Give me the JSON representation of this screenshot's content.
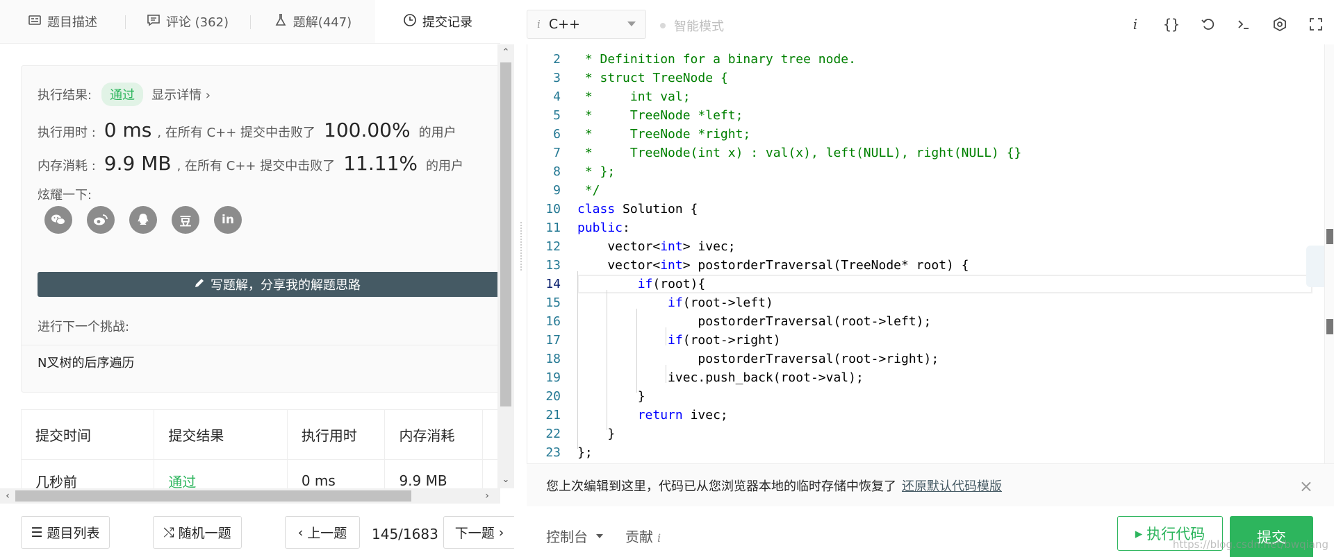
{
  "tabs": [
    {
      "label": "题目描述",
      "icon": "description-icon"
    },
    {
      "label": "评论 (362)",
      "icon": "comment-icon"
    },
    {
      "label": "题解(447)",
      "icon": "flask-icon"
    },
    {
      "label": "提交记录",
      "icon": "clock-icon"
    }
  ],
  "result": {
    "label": "执行结果:",
    "status": "通过",
    "detail": "显示详情 ›",
    "time_label": "执行用时 :",
    "time_value": "0 ms",
    "time_text": ", 在所有 C++ 提交中击败了",
    "time_percent": "100.00%",
    "time_suffix": "的用户",
    "mem_label": "内存消耗 :",
    "mem_value": "9.9 MB",
    "mem_text": ", 在所有 C++ 提交中击败了",
    "mem_percent": "11.11%",
    "mem_suffix": "的用户",
    "share_label": "炫耀一下:",
    "socials": [
      "wechat-icon",
      "weibo-icon",
      "qq-icon",
      "douban-icon",
      "linkedin-icon"
    ],
    "social_glyphs": {
      "douban": "豆",
      "linkedin": "in"
    },
    "write_button": "写题解，分享我的解题思路",
    "next_label": "进行下一个挑战:",
    "next_title": "N叉树的后序遍历"
  },
  "table": {
    "headers": [
      "提交时间",
      "提交结果",
      "执行用时",
      "内存消耗"
    ],
    "rows": [
      {
        "time": "几秒前",
        "result": "通过",
        "runtime": "0 ms",
        "memory": "9.9 MB"
      }
    ]
  },
  "bottom": {
    "list": "题目列表",
    "random": "随机一题",
    "prev": "上一题",
    "page": "145/1683",
    "next": "下一题"
  },
  "editor": {
    "language": "C++",
    "lang_icon": "i",
    "smart_mode": "智能模式",
    "lines": [
      {
        "n": "2",
        "html": "<span class='cm'> * Definition for a binary tree node.</span>"
      },
      {
        "n": "3",
        "html": "<span class='cm'> * struct TreeNode {</span>"
      },
      {
        "n": "4",
        "html": "<span class='cm'> *     int val;</span>"
      },
      {
        "n": "5",
        "html": "<span class='cm'> *     TreeNode *left;</span>"
      },
      {
        "n": "6",
        "html": "<span class='cm'> *     TreeNode *right;</span>"
      },
      {
        "n": "7",
        "html": "<span class='cm'> *     TreeNode(int x) : val(x), left(NULL), right(NULL) {}</span>"
      },
      {
        "n": "8",
        "html": "<span class='cm'> * };</span>"
      },
      {
        "n": "9",
        "html": "<span class='cm'> */</span>"
      },
      {
        "n": "10",
        "html": "<span class='kw'>class</span> Solution {"
      },
      {
        "n": "11",
        "html": "<span class='kw'>public</span>:"
      },
      {
        "n": "12",
        "html": "    vector&lt;<span class='kw'>int</span>&gt; ivec;"
      },
      {
        "n": "13",
        "html": "    vector&lt;<span class='kw'>int</span>&gt; postorderTraversal(TreeNode* root) {"
      },
      {
        "n": "14",
        "html": "        <span class='kw'>if</span>(root){",
        "current": true
      },
      {
        "n": "15",
        "html": "            <span class='kw'>if</span>(root-&gt;left)"
      },
      {
        "n": "16",
        "html": "                postorderTraversal(root-&gt;left);"
      },
      {
        "n": "17",
        "html": "            <span class='kw'>if</span>(root-&gt;right)"
      },
      {
        "n": "18",
        "html": "                postorderTraversal(root-&gt;right);"
      },
      {
        "n": "19",
        "html": "            ivec.push_back(root-&gt;val);"
      },
      {
        "n": "20",
        "html": "        }"
      },
      {
        "n": "21",
        "html": "        <span class='kw'>return</span> ivec;"
      },
      {
        "n": "22",
        "html": "    }"
      },
      {
        "n": "23",
        "html": "};"
      }
    ]
  },
  "notice": {
    "text": "您上次编辑到这里，代码已从您浏览器本地的临时存储中恢复了",
    "link": "还原默认代码模版",
    "close": "×"
  },
  "actions": {
    "console": "控制台",
    "contribute": "贡献",
    "contribute_icon": "i",
    "run": "执行代码",
    "submit": "提交"
  },
  "watermark": "https://blog.csdn.net/bwqiang",
  "colors": {
    "accent": "#2db55d",
    "write_button": "#455a64"
  }
}
